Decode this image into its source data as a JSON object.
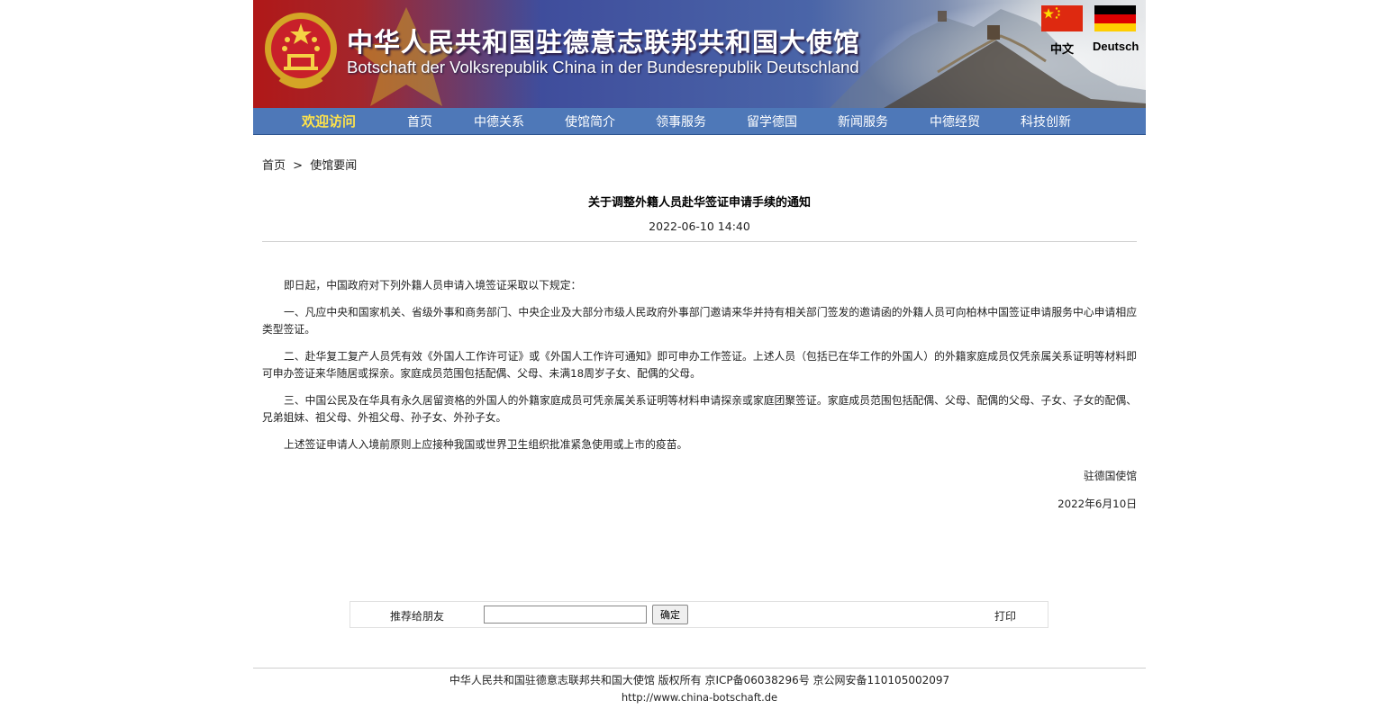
{
  "header": {
    "title_cn": "中华人民共和国驻德意志联邦共和国大使馆",
    "title_de": "Botschaft der Volksrepublik China in der Bundesrepublik Deutschland",
    "lang_cn": "中文",
    "lang_de": "Deutsch"
  },
  "nav": {
    "welcome": "欢迎访问",
    "items": [
      "首页",
      "中德关系",
      "使馆简介",
      "领事服务",
      "留学德国",
      "新闻服务",
      "中德经贸",
      "科技创新"
    ]
  },
  "breadcrumb": {
    "home": "首页",
    "sep": ">",
    "current": "使馆要闻"
  },
  "article": {
    "title": "关于调整外籍人员赴华签证申请手续的通知",
    "date": "2022-06-10 14:40",
    "paragraphs": [
      "即日起，中国政府对下列外籍人员申请入境签证采取以下规定：",
      "一、凡应中央和国家机关、省级外事和商务部门、中央企业及大部分市级人民政府外事部门邀请来华并持有相关部门签发的邀请函的外籍人员可向柏林中国签证申请服务中心申请相应类型签证。",
      "二、赴华复工复产人员凭有效《外国人工作许可证》或《外国人工作许可通知》即可申办工作签证。上述人员（包括已在华工作的外国人）的外籍家庭成员仅凭亲属关系证明等材料即可申办签证来华随居或探亲。家庭成员范围包括配偶、父母、未满18周岁子女、配偶的父母。",
      "三、中国公民及在华具有永久居留资格的外国人的外籍家庭成员可凭亲属关系证明等材料申请探亲或家庭团聚签证。家庭成员范围包括配偶、父母、配偶的父母、子女、子女的配偶、兄弟姐妹、祖父母、外祖父母、孙子女、外孙子女。",
      "上述签证申请人入境前原则上应接种我国或世界卫生组织批准紧急使用或上市的疫苗。"
    ],
    "signature": "驻德国使馆",
    "sign_date": "2022年6月10日"
  },
  "toolbar": {
    "recommend_label": "推荐给朋友",
    "email_value": "",
    "confirm_label": "确定",
    "print_label": "打印"
  },
  "footer": {
    "line1": "中华人民共和国驻德意志联邦共和国大使馆 版权所有 京ICP备06038296号 京公网安备110105002097",
    "line2": "http://www.china-botschaft.de"
  },
  "colors": {
    "nav_bg": "#4e78b8",
    "welcome": "#ffe34a",
    "banner_red": "#b01818",
    "banner_blue": "#3f4d9c"
  },
  "icons": [
    "national-emblem-icon",
    "china-flag-icon",
    "germany-flag-icon",
    "great-wall-icon"
  ]
}
